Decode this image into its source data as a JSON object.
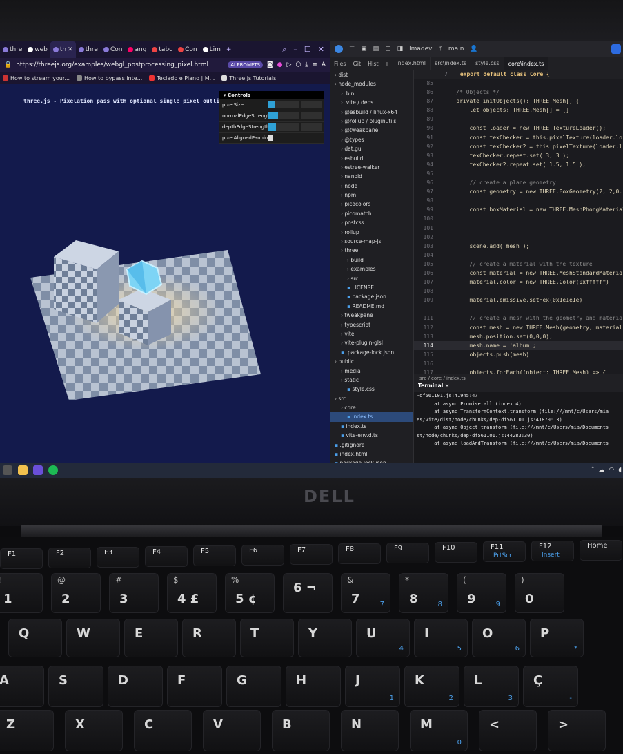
{
  "browser": {
    "tabs": [
      "thre",
      "web",
      "th",
      "thre",
      "Con",
      "ang",
      "tabc",
      "Con",
      "Lim"
    ],
    "url": "https://threejs.org/examples/webgl_postprocessing_pixel.html",
    "url_pill": "AI PROMPTS",
    "bookmarks": [
      "How to stream your...",
      "How to bypass inte...",
      "Teclado e Piano | M...",
      "Three.js Tutorials"
    ],
    "caption": "three.js - Pixelation pass with optional single pixel outlines by",
    "controls": {
      "title": "Controls",
      "rows": [
        {
          "label": "pixelSize",
          "fill": 0.22
        },
        {
          "label": "normalEdgeStrength",
          "fill": 0.32
        },
        {
          "label": "depthEdgeStrength",
          "fill": 0.25
        },
        {
          "label": "pixelAlignedPanning",
          "checked": true
        }
      ]
    }
  },
  "editor": {
    "title_items": [
      "lmadev",
      "main"
    ],
    "side_tabs": [
      "Files",
      "Git",
      "Hist"
    ],
    "file_tabs": [
      "index.html",
      "src\\index.ts",
      "style.css",
      "core\\index.ts"
    ],
    "active_file_tab": "core\\index.ts",
    "tree": [
      "dist",
      "node_modules",
      ".bin",
      ".vite / deps",
      "@esbuild / linux-x64",
      "@rollup / pluginutils",
      "@tweakpane",
      "@types",
      "dat.gui",
      "esbuild",
      "estree-walker",
      "nanoid",
      "node",
      "npm",
      "picocolors",
      "picomatch",
      "postcss",
      "rollup",
      "source-map-js",
      "three",
      "build",
      "examples",
      "src",
      "LICENSE",
      "package.json",
      "README.md",
      "tweakpane",
      "typescript",
      "vite",
      "vite-plugin-glsl",
      ".package-lock.json",
      "public",
      "media",
      "static",
      "style.css",
      "src",
      "core",
      "index.ts",
      "index.ts",
      "vite-env.d.ts",
      ".gitignore",
      "index.html",
      "package-lock.json",
      "package.json"
    ],
    "tree_selected": 37,
    "sticky_header": "export default class Core {",
    "sticky_line": "7",
    "code": [
      {
        "n": "85",
        "t": ""
      },
      {
        "n": "86",
        "t": "    /* Objects */"
      },
      {
        "n": "87",
        "t": "    private initObjects(): THREE.Mesh[] {"
      },
      {
        "n": "88",
        "t": "        let objects: THREE.Mesh[] = []"
      },
      {
        "n": "89",
        "t": ""
      },
      {
        "n": "90",
        "t": "        const loader = new THREE.TextureLoader();"
      },
      {
        "n": "91",
        "t": "        const texChecker = this.pixelTexture(loader.lo"
      },
      {
        "n": "92",
        "t": "        const texChecker2 = this.pixelTexture(loader.l"
      },
      {
        "n": "93",
        "t": "        texChecker.repeat.set( 3, 3 );"
      },
      {
        "n": "94",
        "t": "        texChecker2.repeat.set( 1.5, 1.5 );"
      },
      {
        "n": "95",
        "t": ""
      },
      {
        "n": "96",
        "t": "        // create a plane geometry"
      },
      {
        "n": "97",
        "t": "        const geometry = new THREE.BoxGeometry(2, 2,0.1"
      },
      {
        "n": "98",
        "t": ""
      },
      {
        "n": "99",
        "t": "        const boxMaterial = new THREE.MeshPhongMaterial"
      },
      {
        "n": "100",
        "t": ""
      },
      {
        "n": "101",
        "t": ""
      },
      {
        "n": "102",
        "t": ""
      },
      {
        "n": "103",
        "t": "        scene.add( mesh );"
      },
      {
        "n": "104",
        "t": ""
      },
      {
        "n": "105",
        "t": "        // create a material with the texture"
      },
      {
        "n": "106",
        "t": "        const material = new THREE.MeshStandardMaterial("
      },
      {
        "n": "107",
        "t": "        material.color = new THREE.Color(0xffffff)"
      },
      {
        "n": "108",
        "t": ""
      },
      {
        "n": "109",
        "t": "        material.emissive.setHex(0x1e1e1e)"
      },
      {
        "n": "",
        "t": ""
      },
      {
        "n": "111",
        "t": "        // create a mesh with the geometry and material"
      },
      {
        "n": "112",
        "t": "        const mesh = new THREE.Mesh(geometry, material);"
      },
      {
        "n": "113",
        "t": "        mesh.position.set(0,0,0);"
      },
      {
        "n": "114",
        "t": "        mesh.name = 'album';"
      },
      {
        "n": "115",
        "t": "        objects.push(mesh)"
      },
      {
        "n": "116",
        "t": ""
      },
      {
        "n": "117",
        "t": "        objects.forEach((object: THREE.Mesh) => {"
      }
    ],
    "current_line": "114",
    "breadcrumb": "src / core / index.ts",
    "terminal_title": "Terminal",
    "terminal": [
      "-df561101.js:41945:47",
      "      at async Promise.all (index 4)",
      "      at async TransformContext.transform (file:///mnt/c/Users/mia",
      "es/vite/dist/node/chunks/dep-df561101.js:41870:13)",
      "      at async Object.transform (file:///mnt/c/Users/mia/Documents",
      "st/node/chunks/dep-df561101.js:44283:30)",
      "      at async loadAndTransform (file:///mnt/c/Users/mia/Documents"
    ]
  },
  "laptop": {
    "brand": "DELL",
    "fkeys": [
      "F1",
      "F2",
      "F3",
      "F4",
      "F5",
      "F6",
      "F7",
      "F8",
      "F9",
      "F10",
      "F11",
      "F12",
      "Home"
    ],
    "fkey_sub": {
      "F11": "PrtScr",
      "F12": "Insert"
    },
    "row_numbers": [
      {
        "main": "1",
        "sub": "!"
      },
      {
        "main": "2",
        "sub": "@"
      },
      {
        "main": "3",
        "sub": "#"
      },
      {
        "main": "4 £",
        "sub": "$"
      },
      {
        "main": "5 ¢",
        "sub": "%"
      },
      {
        "main": "6 ¬",
        "sub": ""
      },
      {
        "main": "7",
        "sub": "&",
        "blue": "7"
      },
      {
        "main": "8",
        "sub": "*",
        "blue": "8"
      },
      {
        "main": "9",
        "sub": "(",
        "blue": "9"
      },
      {
        "main": "0",
        "sub": ")"
      }
    ],
    "row_q": [
      {
        "main": "Q"
      },
      {
        "main": "W"
      },
      {
        "main": "E"
      },
      {
        "main": "R"
      },
      {
        "main": "T"
      },
      {
        "main": "Y"
      },
      {
        "main": "U",
        "blue": "4"
      },
      {
        "main": "I",
        "blue": "5"
      },
      {
        "main": "O",
        "blue": "6"
      },
      {
        "main": "P",
        "blue": "*"
      }
    ],
    "row_a": [
      {
        "main": "A"
      },
      {
        "main": "S"
      },
      {
        "main": "D"
      },
      {
        "main": "F"
      },
      {
        "main": "G"
      },
      {
        "main": "H"
      },
      {
        "main": "J",
        "blue": "1"
      },
      {
        "main": "K",
        "blue": "2"
      },
      {
        "main": "L",
        "blue": "3"
      },
      {
        "main": "Ç",
        "blue": "-"
      }
    ],
    "row_z": [
      {
        "main": "Z"
      },
      {
        "main": "X"
      },
      {
        "main": "C"
      },
      {
        "main": "V"
      },
      {
        "main": "B"
      },
      {
        "main": "N"
      },
      {
        "main": "M",
        "blue": "0"
      },
      {
        "main": "<"
      },
      {
        "main": ">"
      }
    ]
  }
}
